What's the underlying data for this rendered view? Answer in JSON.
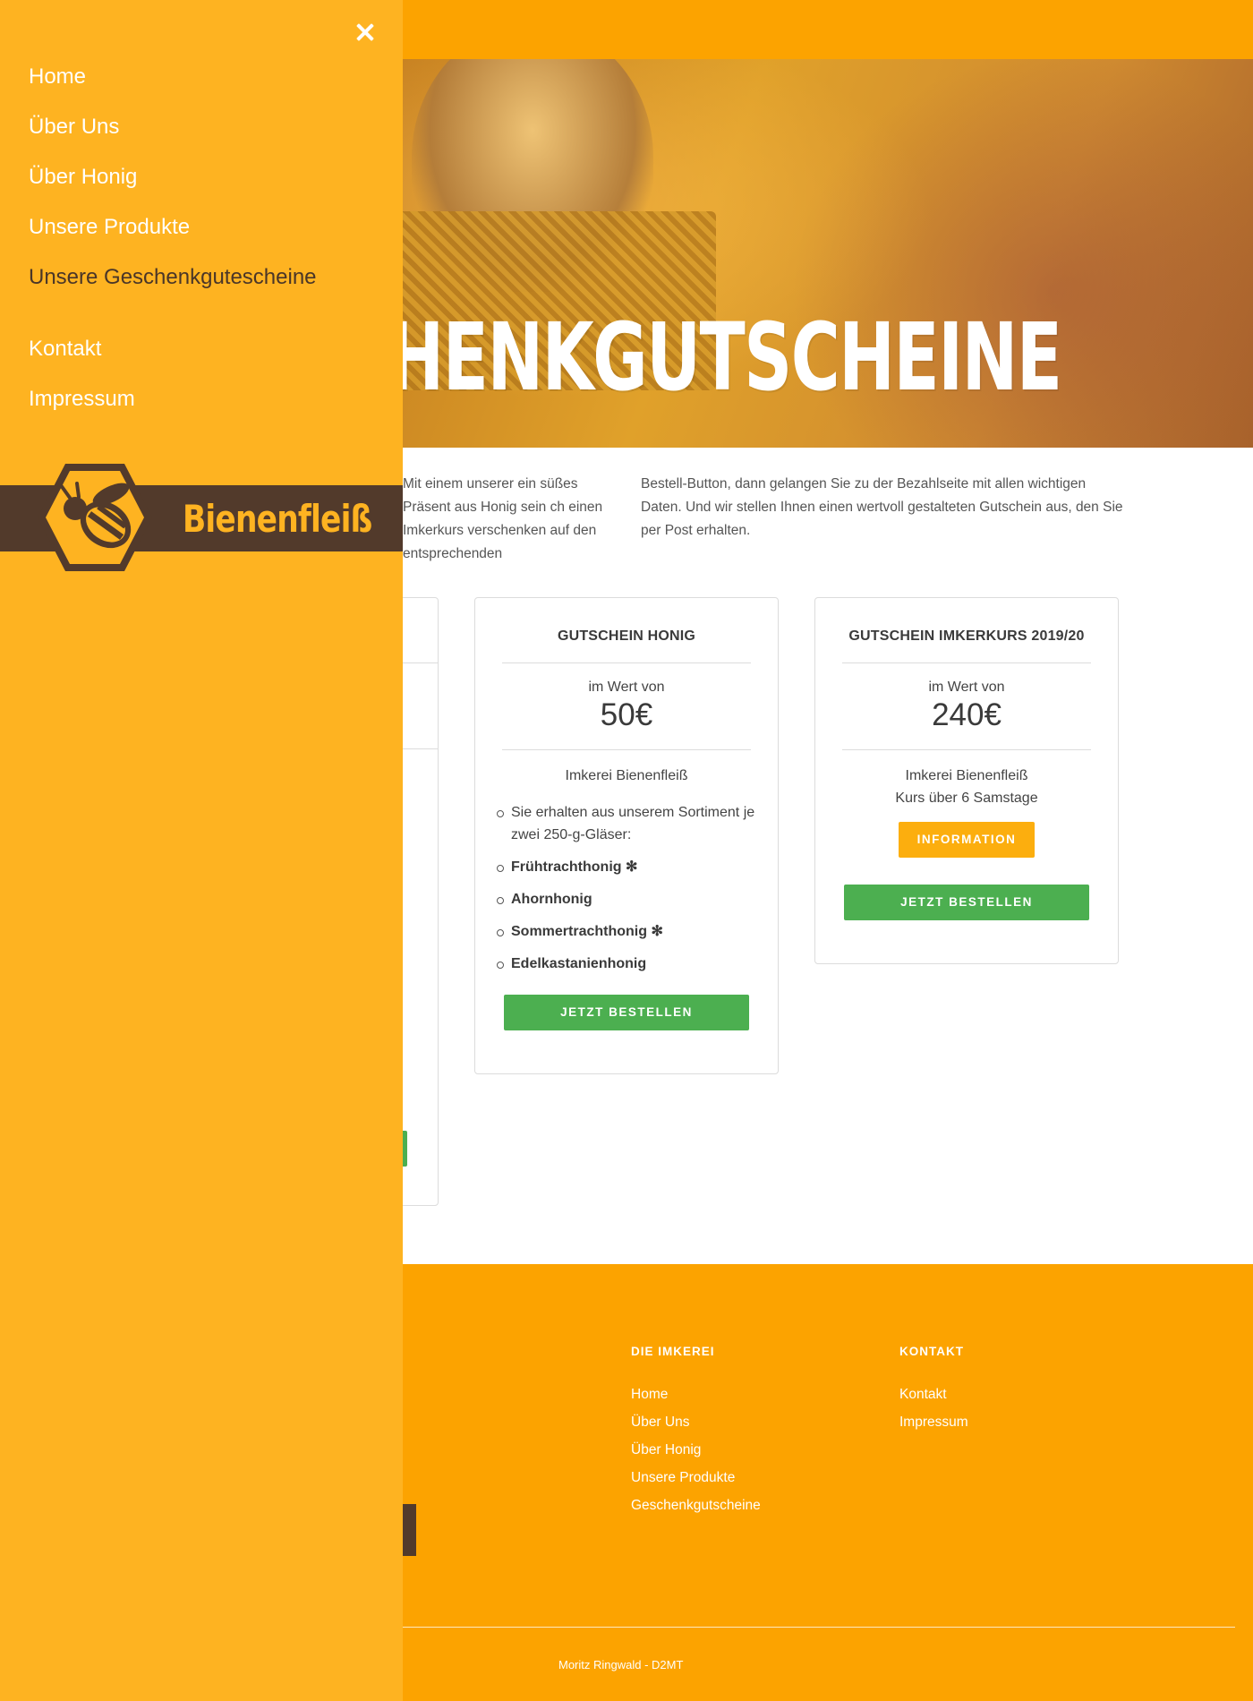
{
  "colors": {
    "brand_orange": "#fca300",
    "drawer_yellow": "#feb321",
    "brown": "#523a2b",
    "green": "#4caf50",
    "button_orange": "#fcae0e"
  },
  "drawer": {
    "close_icon": "close-icon",
    "nav": [
      "Home",
      "Über Uns",
      "Über Honig",
      "Unsere Produkte",
      "Unsere Geschenkguteschein­e"
    ],
    "nav2": [
      "Kontakt",
      "Impressum"
    ],
    "active_index": 4,
    "logo_text": "Bienenfleiß"
  },
  "hero": {
    "title": "CHENKGUTSCHEINE"
  },
  "intro": {
    "left": "Mit einem unserer ein süßes Präsent aus Honig sein ch einen Imkerkurs verschenken auf den entsprechenden",
    "right": "Bestell-Button, dann gelangen Sie zu der Bezahlseite mit allen wichtigen Daten. Und wir stellen Ihnen einen wertvoll gestalteten Gutschein aus, den Sie per Post erhalten."
  },
  "cards": {
    "honig": {
      "title": "GUTSCHEIN HONIG",
      "wert_label": "im Wert von",
      "price": "50€",
      "provider": "Imkerei Bienenfleiß",
      "bullets_intro": "Sie erhalten aus unserem Sortiment je zwei 250-g-Gläser:",
      "items": [
        "Frühtrachthonig ✻",
        "Ahornhonig",
        "Sommertrachthonig ✻",
        "Edelkastanienhonig"
      ],
      "order_button": "JETZT BESTELLEN"
    },
    "imkerkurs": {
      "title": "GUTSCHEIN IMKERKURS 2019/20",
      "wert_label": "im Wert von",
      "price": "240€",
      "provider": "Imkerei Bienenfleiß",
      "detail": "Kurs über 6 Samstage",
      "info_button": "INFORMATION",
      "order_button": "JETZT BESTELLEN"
    }
  },
  "footer": {
    "col1_title": "DIE IMKEREI",
    "col1_links": [
      "Home",
      "Über Uns",
      "Über Honig",
      "Unsere Produkte",
      "Geschenkgutscheine"
    ],
    "col2_title": "KONTAKT",
    "col2_links": [
      "Kontakt",
      "Impressum"
    ],
    "copyright": "Moritz Ringwald - D2MT"
  }
}
